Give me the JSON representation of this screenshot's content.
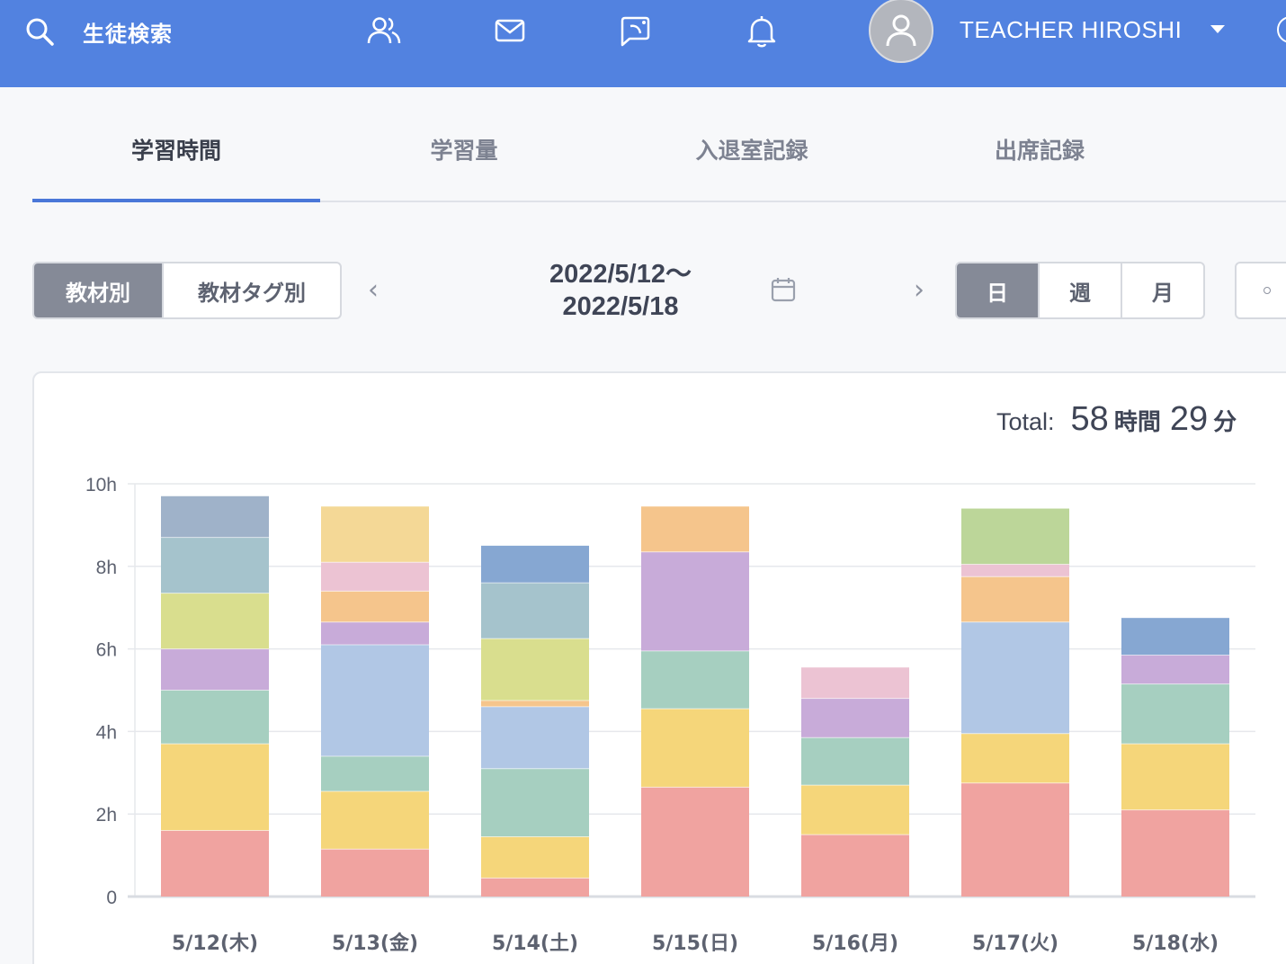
{
  "header": {
    "search_label": "生徒検索",
    "user_name": "TEACHER HIROSHI",
    "bg_color": "#5282e0",
    "icons": [
      "search-icon",
      "users-icon",
      "mail-icon",
      "chat-icon",
      "bell-icon",
      "user-icon",
      "caret-down-icon"
    ]
  },
  "tabs": [
    {
      "label": "学習時間",
      "active": true
    },
    {
      "label": "学習量",
      "active": false
    },
    {
      "label": "入退室記録",
      "active": false
    },
    {
      "label": "出席記録",
      "active": false
    }
  ],
  "view_toggle": [
    {
      "label": "教材別",
      "active": true
    },
    {
      "label": "教材タグ別",
      "active": false
    }
  ],
  "date_range": {
    "line1": "2022/5/12〜",
    "line2": "2022/5/18"
  },
  "period_toggle": [
    {
      "label": "日",
      "active": true
    },
    {
      "label": "週",
      "active": false
    },
    {
      "label": "月",
      "active": false
    }
  ],
  "total": {
    "label": "Total:",
    "hours": "58",
    "hours_unit": "時間",
    "minutes": "29",
    "minutes_unit": "分"
  },
  "chart_data": {
    "type": "bar",
    "stacked": true,
    "categories": [
      "5/12(木)",
      "5/13(金)",
      "5/14(土)",
      "5/15(日)",
      "5/16(月)",
      "5/17(火)",
      "5/18(水)"
    ],
    "y_ticks": [
      "0",
      "2h",
      "4h",
      "6h",
      "8h",
      "10h"
    ],
    "ylim": [
      0,
      10
    ],
    "grid": true,
    "stacks": [
      [
        {
          "value": 1.6,
          "color": "#f0a3a0"
        },
        {
          "value": 2.1,
          "color": "#f5d67a"
        },
        {
          "value": 1.3,
          "color": "#a6cfc0"
        },
        {
          "value": 1.0,
          "color": "#c8abd9"
        },
        {
          "value": 1.35,
          "color": "#d9de8e"
        },
        {
          "value": 1.35,
          "color": "#a5c3cc"
        },
        {
          "value": 1.0,
          "color": "#9fb2c9"
        }
      ],
      [
        {
          "value": 1.15,
          "color": "#f0a3a0"
        },
        {
          "value": 1.4,
          "color": "#f5d67a"
        },
        {
          "value": 0.85,
          "color": "#a6cfc0"
        },
        {
          "value": 2.7,
          "color": "#b1c7e5"
        },
        {
          "value": 0.55,
          "color": "#c8abd9"
        },
        {
          "value": 0.75,
          "color": "#f5c58c"
        },
        {
          "value": 0.7,
          "color": "#ecc3d3"
        },
        {
          "value": 1.35,
          "color": "#f4d896"
        }
      ],
      [
        {
          "value": 0.45,
          "color": "#f0a3a0"
        },
        {
          "value": 1.0,
          "color": "#f5d67a"
        },
        {
          "value": 1.65,
          "color": "#a6cfc0"
        },
        {
          "value": 1.5,
          "color": "#b1c7e5"
        },
        {
          "value": 0.15,
          "color": "#f5c58c"
        },
        {
          "value": 1.5,
          "color": "#d9de8e"
        },
        {
          "value": 1.35,
          "color": "#a5c3cc"
        },
        {
          "value": 0.9,
          "color": "#86a7d2"
        }
      ],
      [
        {
          "value": 2.65,
          "color": "#f0a3a0"
        },
        {
          "value": 1.9,
          "color": "#f5d67a"
        },
        {
          "value": 1.4,
          "color": "#a6cfc0"
        },
        {
          "value": 2.4,
          "color": "#c8abd9"
        },
        {
          "value": 1.1,
          "color": "#f5c58c"
        }
      ],
      [
        {
          "value": 1.5,
          "color": "#f0a3a0"
        },
        {
          "value": 1.2,
          "color": "#f5d67a"
        },
        {
          "value": 1.15,
          "color": "#a6cfc0"
        },
        {
          "value": 0.95,
          "color": "#c8abd9"
        },
        {
          "value": 0.75,
          "color": "#ecc3d3"
        }
      ],
      [
        {
          "value": 2.75,
          "color": "#f0a3a0"
        },
        {
          "value": 1.2,
          "color": "#f5d67a"
        },
        {
          "value": 2.7,
          "color": "#b1c7e5"
        },
        {
          "value": 1.1,
          "color": "#f5c58c"
        },
        {
          "value": 0.3,
          "color": "#ecc3d3"
        },
        {
          "value": 1.35,
          "color": "#bcd699"
        }
      ],
      [
        {
          "value": 2.1,
          "color": "#f0a3a0"
        },
        {
          "value": 1.6,
          "color": "#f5d67a"
        },
        {
          "value": 1.45,
          "color": "#a6cfc0"
        },
        {
          "value": 0.7,
          "color": "#c8abd9"
        },
        {
          "value": 0.9,
          "color": "#86a7d2"
        }
      ]
    ]
  }
}
